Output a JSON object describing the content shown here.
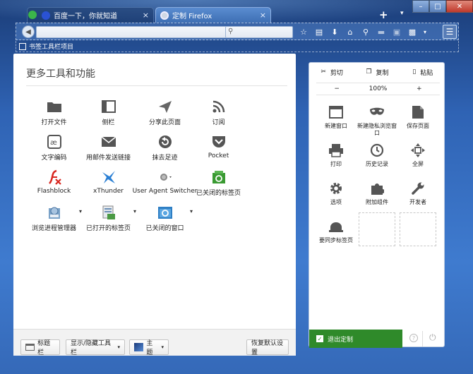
{
  "tabs": [
    {
      "title": "百度一下，你就知道",
      "close": "×"
    },
    {
      "title": "定制 Firefox",
      "close": "×"
    }
  ],
  "tabstrip": {
    "new_tab": "+",
    "list_all": "▾"
  },
  "window": {
    "minimize": "–",
    "maximize": "□",
    "close": "✕"
  },
  "bookmarks_bar": {
    "label": "书签工具栏项目"
  },
  "palette": {
    "title": "更多工具和功能",
    "items": [
      {
        "label": "打开文件",
        "icon": "folder-icon"
      },
      {
        "label": "侧栏",
        "icon": "sidebar-icon"
      },
      {
        "label": "分享此页面",
        "icon": "share-icon"
      },
      {
        "label": "订阅",
        "icon": "rss-icon"
      },
      {
        "label": "文字编码",
        "icon": "encoding-icon"
      },
      {
        "label": "用邮件发送链接",
        "icon": "email-icon"
      },
      {
        "label": "抹去足迹",
        "icon": "forget-icon"
      },
      {
        "label": "Pocket",
        "icon": "pocket-icon"
      },
      {
        "label": "Flashblock",
        "icon": "flashblock-icon"
      },
      {
        "label": "xThunder",
        "icon": "xthunder-icon"
      },
      {
        "label": "User Agent Switcher",
        "icon": "ua-switcher-icon"
      },
      {
        "label": "已关闭的标签页",
        "icon": "closed-tabs-icon"
      },
      {
        "label": "浏览进程管理器",
        "icon": "process-manager-icon"
      },
      {
        "label": "已打开的标签页",
        "icon": "open-tabs-icon"
      },
      {
        "label": "已关闭的窗口",
        "icon": "closed-windows-icon"
      }
    ],
    "bottom": {
      "title_bar": "标题栏",
      "toolbars": "显示/隐藏工具栏",
      "themes": "主题",
      "restore": "恢复默认设置"
    }
  },
  "menu_panel": {
    "cut": "剪切",
    "copy": "复制",
    "paste": "粘贴",
    "zoom_out": "−",
    "zoom_level": "100%",
    "zoom_in": "+",
    "items": [
      {
        "label": "新建窗口",
        "icon": "new-window-icon"
      },
      {
        "label": "新建隐私浏览窗口",
        "icon": "private-mask-icon"
      },
      {
        "label": "保存页面",
        "icon": "save-page-icon"
      },
      {
        "label": "打印",
        "icon": "print-icon"
      },
      {
        "label": "历史记录",
        "icon": "history-icon"
      },
      {
        "label": "全屏",
        "icon": "fullscreen-icon"
      },
      {
        "label": "选项",
        "icon": "gear-icon"
      },
      {
        "label": "附加组件",
        "icon": "puzzle-icon"
      },
      {
        "label": "开发者",
        "icon": "wrench-icon"
      },
      {
        "label": "要同步标签页",
        "icon": "sync-icon"
      }
    ],
    "exit_customize": "退出定制",
    "help": "?"
  },
  "colors": {
    "accent_green": "#2f8a2a",
    "panel_border": "#b8c8df"
  }
}
